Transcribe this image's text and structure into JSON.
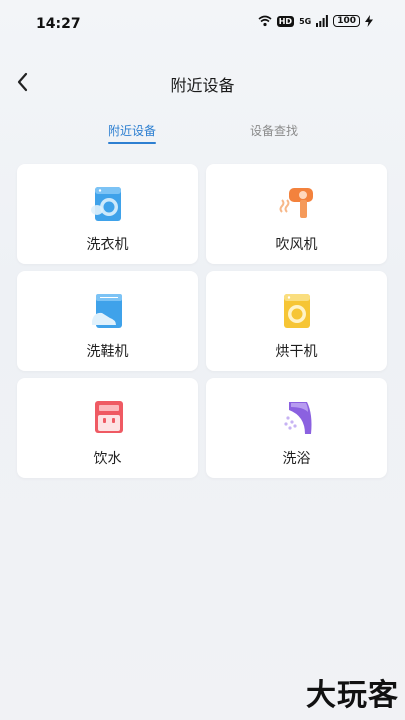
{
  "status_bar": {
    "time": "14:27",
    "hd": "HD",
    "network": "5G",
    "battery": "100"
  },
  "header": {
    "title": "附近设备"
  },
  "tabs": [
    {
      "label": "附近设备"
    },
    {
      "label": "设备查找"
    }
  ],
  "devices": [
    {
      "label": "洗衣机",
      "icon": "washing-machine-icon"
    },
    {
      "label": "吹风机",
      "icon": "hair-dryer-icon"
    },
    {
      "label": "洗鞋机",
      "icon": "shoe-washer-icon"
    },
    {
      "label": "烘干机",
      "icon": "dryer-icon"
    },
    {
      "label": "饮水",
      "icon": "water-dispenser-icon"
    },
    {
      "label": "洗浴",
      "icon": "shower-icon"
    }
  ],
  "watermark": "大玩客",
  "colors": {
    "accent": "#2d7fd1",
    "background": "#f1f3f6"
  }
}
